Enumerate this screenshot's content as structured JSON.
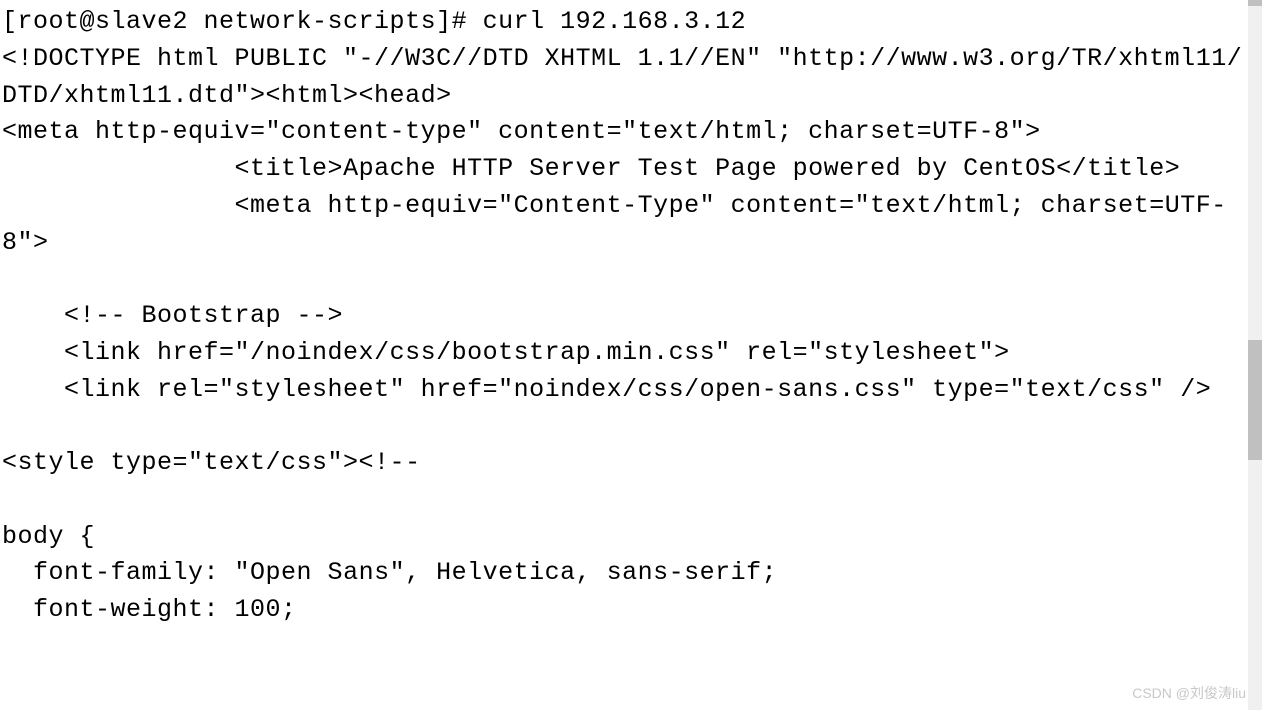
{
  "terminal": {
    "prompt": "[root@slave2 network-scripts]# ",
    "command": "curl 192.168.3.12",
    "output_lines": [
      "<!DOCTYPE html PUBLIC \"-//W3C//DTD XHTML 1.1//EN\" \"http://www.w3.org/TR/xhtml11/DTD/xhtml11.dtd\"><html><head>",
      "<meta http-equiv=\"content-type\" content=\"text/html; charset=UTF-8\">",
      "               <title>Apache HTTP Server Test Page powered by CentOS</title>",
      "               <meta http-equiv=\"Content-Type\" content=\"text/html; charset=UTF-8\">",
      "",
      "    <!-- Bootstrap -->",
      "    <link href=\"/noindex/css/bootstrap.min.css\" rel=\"stylesheet\">",
      "    <link rel=\"stylesheet\" href=\"noindex/css/open-sans.css\" type=\"text/css\" />",
      "",
      "<style type=\"text/css\"><!--",
      "",
      "body {",
      "  font-family: \"Open Sans\", Helvetica, sans-serif;",
      "  font-weight: 100;"
    ]
  },
  "watermark": {
    "text": "CSDN @刘俊涛liu"
  }
}
